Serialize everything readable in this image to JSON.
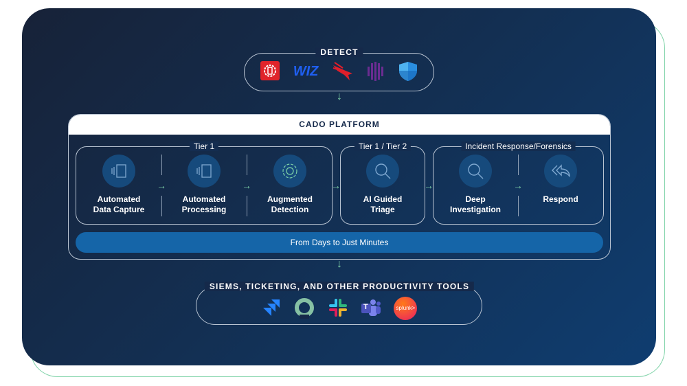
{
  "detect": {
    "title": "DETECT",
    "logos": [
      "aws-security-hub-logo",
      "wiz-logo",
      "crowdstrike-logo",
      "sentinelone-logo",
      "microsoft-defender-logo"
    ],
    "wiz_text": "WIZ"
  },
  "platform": {
    "title": "CADO PLATFORM",
    "tiers": [
      {
        "label": "Tier 1"
      },
      {
        "label": "Tier 1 / Tier 2"
      },
      {
        "label": "Incident Response/Forensics"
      }
    ],
    "steps": [
      {
        "l1": "Automated",
        "l2": "Data Capture",
        "icon": "data-capture-icon"
      },
      {
        "l1": "Automated",
        "l2": "Processing",
        "icon": "processing-icon"
      },
      {
        "l1": "Augmented",
        "l2": "Detection",
        "icon": "gear-icon"
      },
      {
        "l1": "AI Guided",
        "l2": "Triage",
        "icon": "search-icon"
      },
      {
        "l1": "Deep",
        "l2": "Investigation",
        "icon": "search-icon"
      },
      {
        "l1": "Respond",
        "l2": "",
        "icon": "reply-all-icon"
      }
    ],
    "banner": "From Days to Just Minutes"
  },
  "tools": {
    "title": "SIEMS, TICKETING, AND OTHER PRODUCTIVITY TOOLS",
    "logos": [
      "jira-logo",
      "opsgenie-logo",
      "slack-logo",
      "microsoft-teams-logo",
      "splunk-logo"
    ],
    "splunk_text": "splunk>",
    "teams_text": "T"
  },
  "colors": {
    "accent": "#7fd3a8",
    "banner": "#1565a8",
    "circle": "#164a7c"
  }
}
